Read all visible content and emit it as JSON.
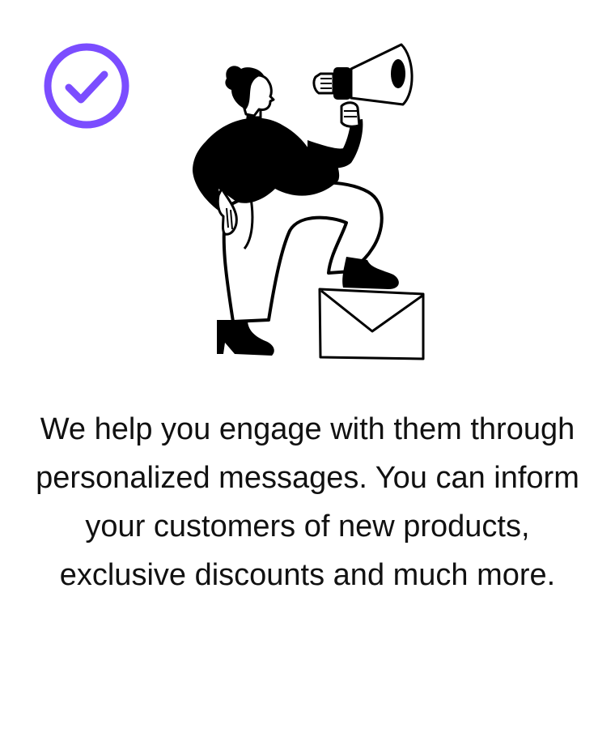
{
  "colors": {
    "accent": "#7B4DFF",
    "ink": "#000000",
    "text": "#111111",
    "background": "#FFFFFF"
  },
  "icons": {
    "badge": "check-circle-icon",
    "illustration": "woman-with-megaphone-on-envelope"
  },
  "message": {
    "text": "We help you engage with them through personalized messages. You can inform your customers of new products, exclusive discounts and much more."
  }
}
